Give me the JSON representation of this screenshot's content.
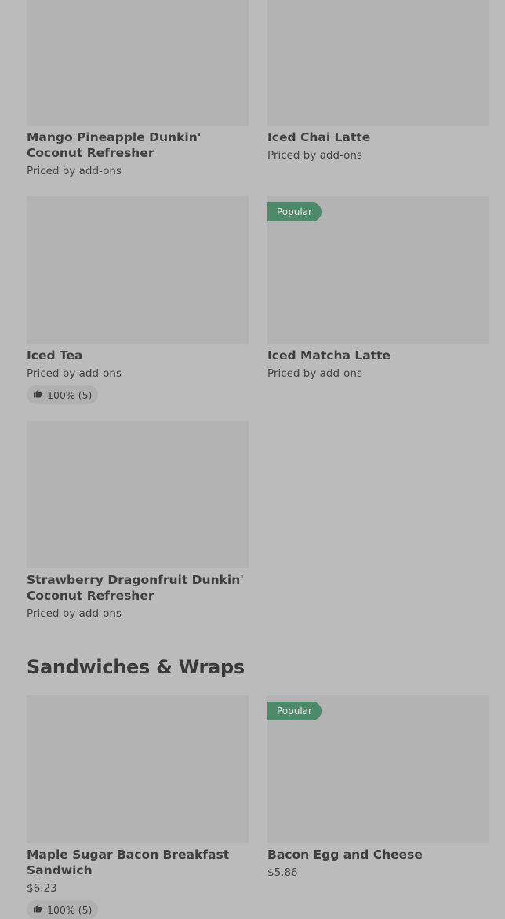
{
  "items": [
    {
      "name": "Mango Pineapple Dunkin' Coconut Refresher",
      "price": "Priced by add-ons"
    },
    {
      "name": "Iced Chai Latte",
      "price": "Priced by add-ons"
    },
    {
      "name": "Iced Tea",
      "price": "Priced by add-ons",
      "rating": "100% (5)"
    },
    {
      "name": "Iced Matcha Latte",
      "price": "Priced by add-ons",
      "badge": "Popular"
    },
    {
      "name": "Strawberry Dragonfruit Dunkin' Coconut Refresher",
      "price": "Priced by add-ons"
    }
  ],
  "section": {
    "title": "Sandwiches & Wraps"
  },
  "sandwiches": [
    {
      "name": "Maple Sugar Bacon Breakfast Sandwich",
      "price": "$6.23",
      "rating": "100% (5)"
    },
    {
      "name": "Bacon Egg and Cheese",
      "price": "$5.86",
      "badge": "Popular"
    }
  ],
  "colors": {
    "badge": "#4c8a69",
    "background": "#bbbbbb",
    "image_placeholder": "#b3b3b3"
  },
  "icons": {
    "rating": "thumbs-up-icon"
  }
}
